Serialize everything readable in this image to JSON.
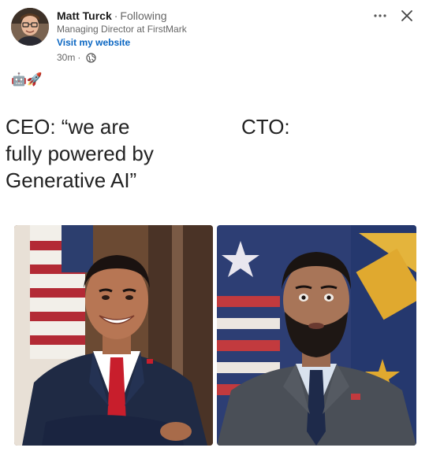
{
  "author": {
    "name": "Matt Turck",
    "follow_state": "Following",
    "headline": "Managing Director at FirstMark",
    "website_link": "Visit my website",
    "time_ago": "30m"
  },
  "icons": {
    "more": "more-options-icon",
    "close": "close-icon",
    "visibility": "globe-icon"
  },
  "post": {
    "emoji_text": "🤖🚀"
  },
  "meme": {
    "left_caption": "CEO: “we are\nfully powered by\nGenerative AI”",
    "right_caption": "CTO:"
  },
  "colors": {
    "link": "#0a66c2",
    "secondary_text": "#666666"
  }
}
